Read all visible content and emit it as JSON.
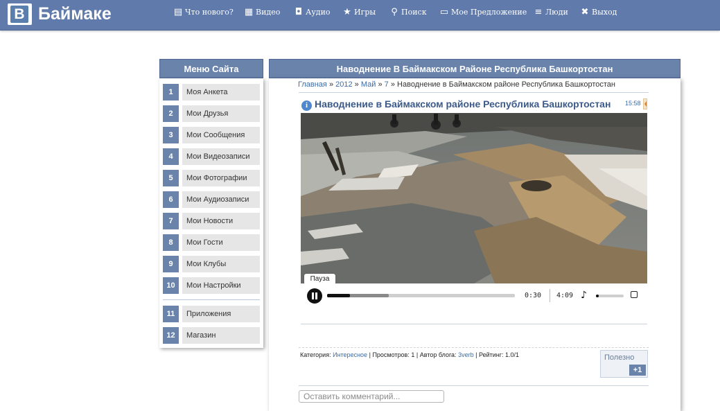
{
  "brand": {
    "letter": "В",
    "name": "Баймаке"
  },
  "nav": [
    {
      "icon": "news-icon",
      "glyph": "▤",
      "label": "Что нового?"
    },
    {
      "icon": "video-icon",
      "glyph": "▦",
      "label": "Видео"
    },
    {
      "icon": "audio-icon",
      "glyph": "◘",
      "label": "Аудио"
    },
    {
      "icon": "star-icon",
      "glyph": "★",
      "label": "Игры"
    },
    {
      "icon": "search-icon",
      "glyph": "⚲",
      "label": "Поиск"
    },
    {
      "icon": "monitor-icon",
      "glyph": "▭",
      "label": "Мое Предложение"
    },
    {
      "icon": "list-icon",
      "glyph": "≡",
      "label": "Люди"
    },
    {
      "icon": "close-icon",
      "glyph": "✖",
      "label": "Выход"
    }
  ],
  "menu": {
    "title": "Меню Сайта",
    "items": [
      {
        "num": "1",
        "label": "Моя Анкета"
      },
      {
        "num": "2",
        "label": "Мои Друзья"
      },
      {
        "num": "3",
        "label": "Мои Сообщения"
      },
      {
        "num": "4",
        "label": "Мои Видеозаписи"
      },
      {
        "num": "5",
        "label": "Мои Фотографии"
      },
      {
        "num": "6",
        "label": "Мои Аудиозаписи"
      },
      {
        "num": "7",
        "label": "Мои Новости"
      },
      {
        "num": "8",
        "label": "Мои Гости"
      },
      {
        "num": "9",
        "label": "Мои Клубы"
      },
      {
        "num": "10",
        "label": "Мои Настройки"
      }
    ],
    "extra": [
      {
        "num": "11",
        "label": "Приложения"
      },
      {
        "num": "12",
        "label": "Магазин"
      }
    ]
  },
  "content": {
    "header": "Наводнение В Баймакском Районе Республика Башкортостан",
    "breadcrumb": {
      "home": "Главная",
      "year": "2012",
      "month": "Май",
      "day": "7",
      "sep": "»",
      "current": "Наводнение в Баймакском районе Республика Башкортостан"
    },
    "title": "Наводнение в Баймакском районе Республика Башкортостан",
    "time": "15:58"
  },
  "player": {
    "tooltip": "Пауза",
    "current_time": "0:30",
    "duration": "4:09",
    "played_fraction": 0.12,
    "buffered_fraction": 0.33,
    "volume_fraction": 0.1
  },
  "meta": {
    "category_label": "Категория:",
    "category": "Интересное",
    "views_label": "Просмотров:",
    "views": "1",
    "author_label": "Автор блога:",
    "author": "3verb",
    "rating_label": "Рейтинг:",
    "rating": "1.0/1",
    "sep": "|"
  },
  "useful": {
    "label": "Полезно",
    "count": "+1"
  },
  "comment": {
    "placeholder": "Оставить комментарий..."
  }
}
